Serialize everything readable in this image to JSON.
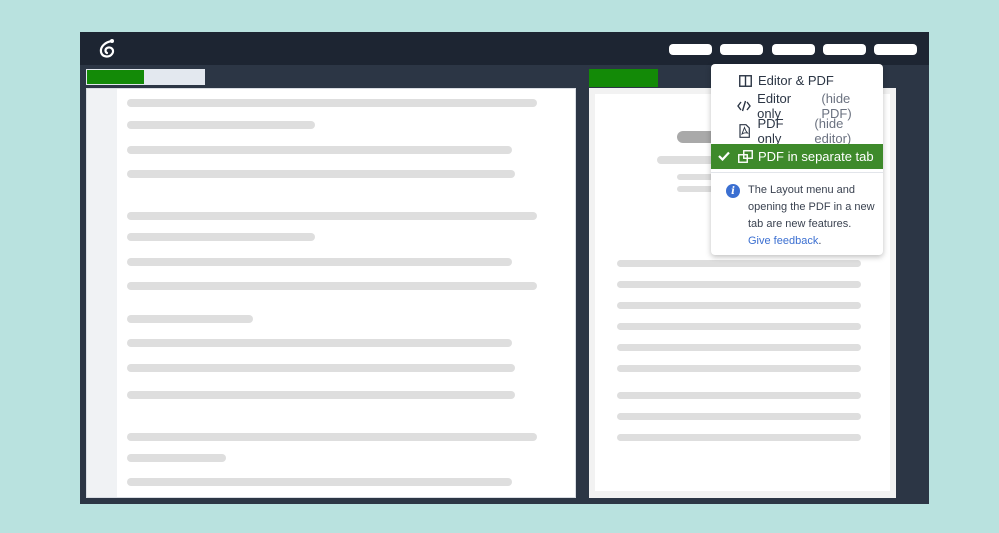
{
  "layout_menu": {
    "items": [
      {
        "label": "Editor & PDF",
        "sub": "",
        "icon": "split-view-icon",
        "selected": false
      },
      {
        "label": "Editor only",
        "sub": "(hide PDF)",
        "icon": "code-icon",
        "selected": false
      },
      {
        "label": "PDF only",
        "sub": "(hide editor)",
        "icon": "pdf-file-icon",
        "selected": false
      },
      {
        "label": "PDF in separate tab",
        "sub": "",
        "icon": "new-window-icon",
        "selected": true
      }
    ],
    "info_text": "The Layout menu and opening the PDF in a new tab are new features.",
    "feedback_link": "Give feedback",
    "feedback_suffix": "."
  },
  "colors": {
    "accent_green": "#138a07",
    "menu_active": "#3e8a2b",
    "topbar": "#1d2532",
    "window_bg": "#2c3645",
    "link_blue": "#3b6fd1"
  }
}
